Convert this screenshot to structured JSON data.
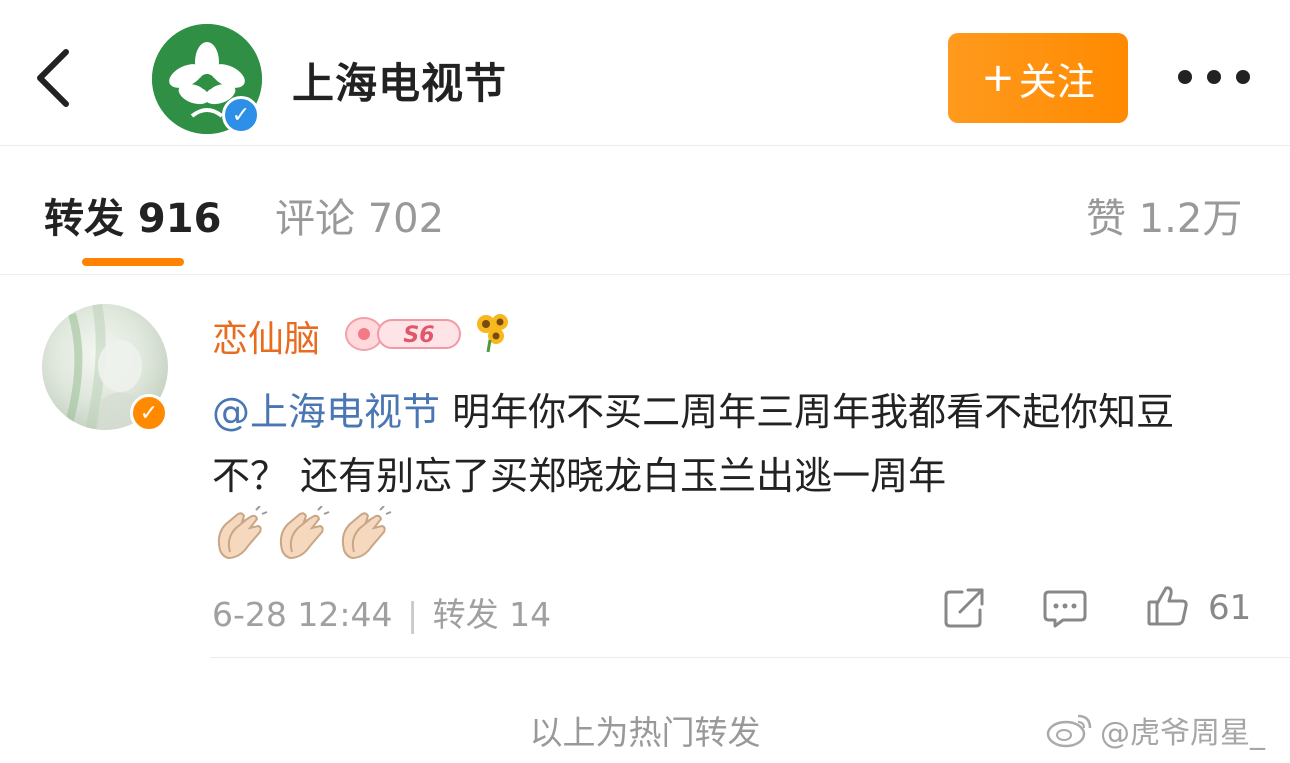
{
  "header": {
    "account_name": "上海电视节",
    "follow_label": "关注",
    "follow_plus": "+",
    "icons": {
      "back": "back-arrow-icon",
      "more": "more-dots-icon",
      "verified": "verified-badge-icon"
    }
  },
  "tabs": {
    "repost": "转发 916",
    "comment": "评论 702",
    "like": "赞 1.2万"
  },
  "comment": {
    "username": "恋仙脑",
    "vip_badge": "S6",
    "mention": "@上海电视节",
    "text": " 明年你不买二周年三周年我都看不起你知豆不？ 还有别忘了买郑晓龙白玉兰出逃一周年",
    "emoji": [
      "clapping-hands",
      "clapping-hands",
      "clapping-hands"
    ],
    "time": "6-28 12:44",
    "separator": "|",
    "repost_info": "转发 14",
    "like_count": "61"
  },
  "footer": {
    "note": "以上为热门转发",
    "watermark": "@虎爷周星_"
  },
  "colors": {
    "accent_orange": "#ff8200",
    "mention_blue": "#4a77b4",
    "username_orange": "#e86b1f",
    "verified_blue": "#2e8fe8",
    "avatar_green": "#2f8f45"
  }
}
